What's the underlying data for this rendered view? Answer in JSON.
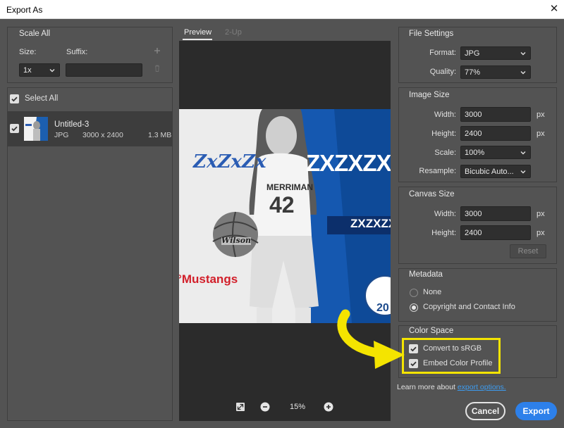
{
  "window": {
    "title": "Export As",
    "close_glyph": "✕"
  },
  "scale_all": {
    "title": "Scale All",
    "size_label": "Size:",
    "suffix_label": "Suffix:",
    "size_value": "1x",
    "suffix_value": "",
    "add_icon": "plus-icon",
    "delete_icon": "trash-icon"
  },
  "select_all": {
    "label": "Select All",
    "checked": true
  },
  "file": {
    "name": "Untitled-3",
    "format": "JPG",
    "dimensions": "3000 x 2400",
    "size": "1.3 MB",
    "checked": true
  },
  "preview": {
    "tabs": [
      {
        "label": "Preview",
        "active": true
      },
      {
        "label": "2-Up",
        "active": false
      }
    ],
    "zoom": "15%",
    "artboard_text_left": "ZxZxZx",
    "artboard_text_right": "ZXZXZX",
    "artboard_banner": "ZXZXZX",
    "jersey_team": "MERRIMAN",
    "jersey_number": "42",
    "ball_brand": "Wilson",
    "mustangs": "Mustangs",
    "mustangs_prefix": "°",
    "seal_number": "20"
  },
  "file_settings": {
    "title": "File Settings",
    "format_label": "Format:",
    "format_value": "JPG",
    "quality_label": "Quality:",
    "quality_value": "77%"
  },
  "image_size": {
    "title": "Image Size",
    "width_label": "Width:",
    "width_value": "3000",
    "height_label": "Height:",
    "height_value": "2400",
    "unit": "px",
    "scale_label": "Scale:",
    "scale_value": "100%",
    "resample_label": "Resample:",
    "resample_value": "Bicubic Auto..."
  },
  "canvas_size": {
    "title": "Canvas Size",
    "width_label": "Width:",
    "width_value": "3000",
    "height_label": "Height:",
    "height_value": "2400",
    "unit": "px",
    "reset_label": "Reset"
  },
  "metadata": {
    "title": "Metadata",
    "options": [
      {
        "label": "None",
        "selected": false
      },
      {
        "label": "Copyright and Contact Info",
        "selected": true
      }
    ]
  },
  "color_space": {
    "title": "Color Space",
    "convert_label": "Convert to sRGB",
    "convert_checked": true,
    "embed_label": "Embed Color Profile",
    "embed_checked": true
  },
  "footer": {
    "learn_more_text": "Learn more about",
    "learn_more_link": "export options.",
    "cancel_label": "Cancel",
    "export_label": "Export"
  },
  "colors": {
    "accent": "#2d80ea",
    "highlight": "#f4e400",
    "link": "#3d9cf0",
    "panel_bg": "#535353"
  }
}
